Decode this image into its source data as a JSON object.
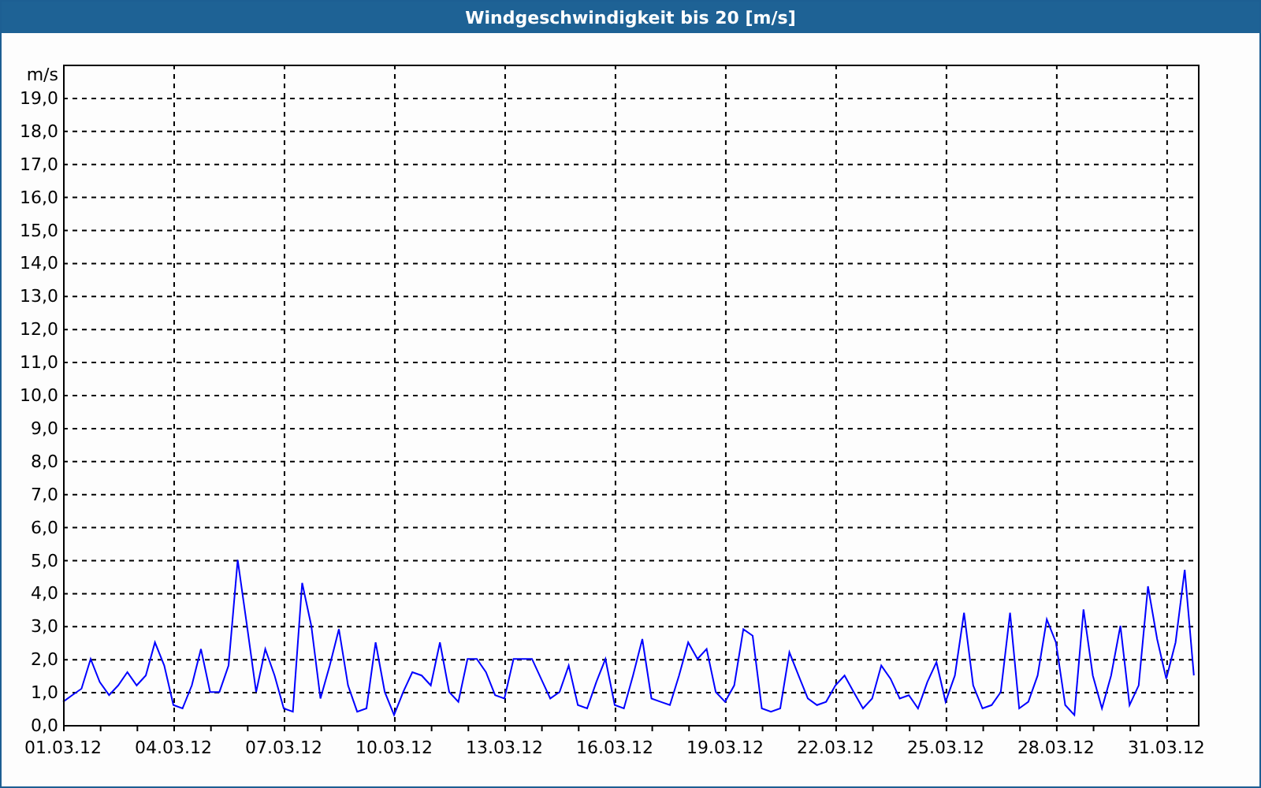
{
  "title": "Windgeschwindigkeit bis 20 [m/s]",
  "chart_data": {
    "type": "line",
    "grid": true,
    "ylabel": "m/s",
    "ylim": [
      0,
      20
    ],
    "yticks": [
      {
        "value": 0,
        "label": "0,0"
      },
      {
        "value": 1,
        "label": "1,0"
      },
      {
        "value": 2,
        "label": "2,0"
      },
      {
        "value": 3,
        "label": "3,0"
      },
      {
        "value": 4,
        "label": "4,0"
      },
      {
        "value": 5,
        "label": "5,0"
      },
      {
        "value": 6,
        "label": "6,0"
      },
      {
        "value": 7,
        "label": "7,0"
      },
      {
        "value": 8,
        "label": "8,0"
      },
      {
        "value": 9,
        "label": "9,0"
      },
      {
        "value": 10,
        "label": "10,0"
      },
      {
        "value": 11,
        "label": "11,0"
      },
      {
        "value": 12,
        "label": "12,0"
      },
      {
        "value": 13,
        "label": "13,0"
      },
      {
        "value": 14,
        "label": "14,0"
      },
      {
        "value": 15,
        "label": "15,0"
      },
      {
        "value": 16,
        "label": "16,0"
      },
      {
        "value": 17,
        "label": "17,0"
      },
      {
        "value": 18,
        "label": "18,0"
      },
      {
        "value": 19,
        "label": "19,0"
      }
    ],
    "categories": [
      "01.03.12",
      null,
      null,
      null,
      null,
      null,
      null,
      null,
      null,
      null,
      null,
      null,
      "04.03.12",
      null,
      null,
      null,
      null,
      null,
      null,
      null,
      null,
      null,
      null,
      null,
      "07.03.12",
      null,
      null,
      null,
      null,
      null,
      null,
      null,
      null,
      null,
      null,
      null,
      "10.03.12",
      null,
      null,
      null,
      null,
      null,
      null,
      null,
      null,
      null,
      null,
      null,
      "13.03.12",
      null,
      null,
      null,
      null,
      null,
      null,
      null,
      null,
      null,
      null,
      null,
      "16.03.12",
      null,
      null,
      null,
      null,
      null,
      null,
      null,
      null,
      null,
      null,
      null,
      "19.03.12",
      null,
      null,
      null,
      null,
      null,
      null,
      null,
      null,
      null,
      null,
      null,
      "22.03.12",
      null,
      null,
      null,
      null,
      null,
      null,
      null,
      null,
      null,
      null,
      null,
      "25.03.12",
      null,
      null,
      null,
      null,
      null,
      null,
      null,
      null,
      null,
      null,
      null,
      "28.03.12",
      null,
      null,
      null,
      null,
      null,
      null,
      null,
      null,
      null,
      null,
      null,
      "31.03.12",
      null,
      null,
      null
    ],
    "series": [
      {
        "color": "#0000ff",
        "values": [
          0.7,
          0.9,
          1.1,
          2.0,
          1.3,
          0.9,
          1.2,
          1.6,
          1.2,
          1.5,
          2.5,
          1.8,
          0.6,
          0.5,
          1.2,
          2.3,
          1.0,
          1.0,
          1.8,
          5.0,
          3.0,
          1.0,
          2.3,
          1.5,
          0.5,
          0.4,
          4.3,
          3.0,
          0.8,
          1.8,
          2.9,
          1.2,
          0.4,
          0.5,
          2.5,
          1.0,
          0.3,
          1.0,
          1.6,
          1.5,
          1.2,
          2.5,
          1.0,
          0.7,
          2.0,
          2.0,
          1.6,
          0.9,
          0.8,
          2.0,
          2.0,
          2.0,
          1.4,
          0.8,
          1.0,
          1.8,
          0.6,
          0.5,
          1.3,
          2.0,
          0.6,
          0.5,
          1.5,
          2.6,
          0.8,
          0.7,
          0.6,
          1.5,
          2.5,
          2.0,
          2.3,
          1.0,
          0.7,
          1.2,
          2.9,
          2.7,
          0.5,
          0.4,
          0.5,
          2.2,
          1.5,
          0.8,
          0.6,
          0.7,
          1.2,
          1.5,
          1.0,
          0.5,
          0.8,
          1.8,
          1.4,
          0.8,
          0.9,
          0.5,
          1.3,
          1.9,
          0.7,
          1.5,
          3.4,
          1.2,
          0.5,
          0.6,
          1.0,
          3.4,
          0.5,
          0.7,
          1.5,
          3.2,
          2.5,
          0.6,
          0.3,
          3.5,
          1.5,
          0.5,
          1.5,
          3.0,
          0.6,
          1.2,
          4.2,
          2.6,
          1.4,
          2.5,
          4.7,
          1.5
        ]
      }
    ]
  }
}
